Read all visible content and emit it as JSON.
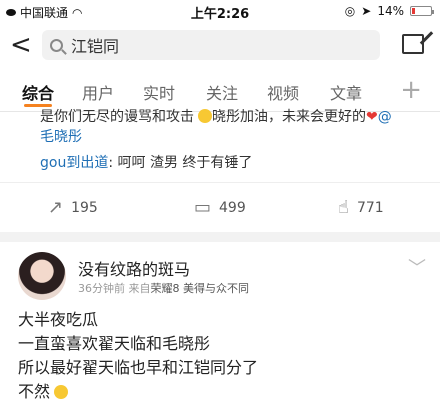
{
  "status_bar": {
    "carrier": "中国联通",
    "time": "上午2:26",
    "battery": "14%"
  },
  "search": {
    "query": "江铠同"
  },
  "tabs": [
    "综合",
    "用户",
    "实时",
    "关注",
    "视频",
    "文章"
  ],
  "post1": {
    "clipped_line": "是你们无尽的谩骂和攻击",
    "clipped_line_end": "晓彤加油，未来会更好的",
    "mention_at": "@",
    "mention": "毛晓彤",
    "reply_user": "gou到出道",
    "reply_text": ": 呵呵 渣男 终于有锤了",
    "reposts": "195",
    "comments": "499",
    "likes": "771"
  },
  "post2": {
    "username": "没有纹路的斑马",
    "time": "36分钟前",
    "source_prefix": "来自",
    "source": "荣耀8 美得与众不同",
    "lines": [
      "大半夜吃瓜",
      "一直蛮喜欢翟天临和毛晓彤",
      "所以最好翟天临也早和江铠同分了",
      "不然"
    ]
  }
}
